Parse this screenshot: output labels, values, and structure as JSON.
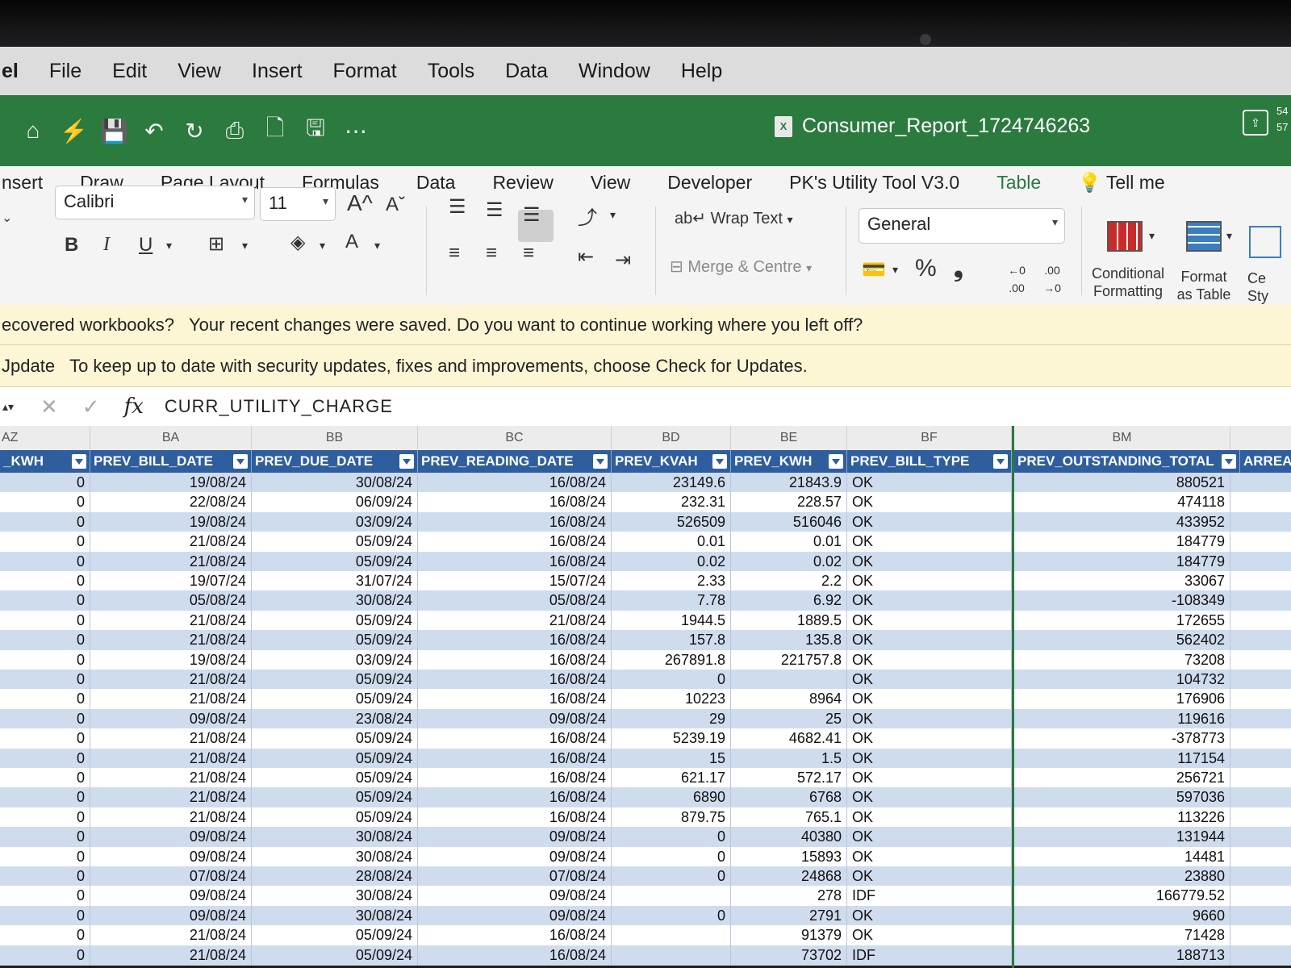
{
  "menu": [
    "el",
    "File",
    "Edit",
    "View",
    "Insert",
    "Format",
    "Tools",
    "Data",
    "Window",
    "Help"
  ],
  "title_bar": {
    "document_title": "Consumer_Report_1724746263",
    "clock": [
      "54",
      "57"
    ],
    "qat_icons": [
      "home-icon",
      "autosave-icon",
      "save-icon",
      "undo-icon",
      "redo-icon",
      "print-icon",
      "new-icon",
      "save-as-icon",
      "more-icon"
    ]
  },
  "ribbon_tabs": [
    "nsert",
    "Draw",
    "Page Layout",
    "Formulas",
    "Data",
    "Review",
    "View",
    "Developer",
    "PK's Utility Tool V3.0",
    "Table",
    "Tell me"
  ],
  "ribbon": {
    "font_name": "Calibri",
    "font_size": "11",
    "grow_font": "A^",
    "shrink_font": "Aˇ",
    "bold": "B",
    "italic": "I",
    "underline": "U",
    "wrap_text": "Wrap Text",
    "merge_centre": "Merge & Centre",
    "number_format": "General",
    "percent": "%",
    "comma": "❟",
    "increase_decimal": "←0 .00",
    "decrease_decimal": ".00 →0",
    "conditional_formatting": [
      "Conditional",
      "Formatting"
    ],
    "format_as_table": [
      "Format",
      "as Table"
    ],
    "cell_styles": [
      "Ce",
      "Sty"
    ]
  },
  "messages": [
    {
      "title": "ecovered workbooks?",
      "text": "Your recent changes were saved. Do you want to continue working where you left off?"
    },
    {
      "title": "Jpdate",
      "text": "To keep up to date with security updates, fixes and improvements, choose Check for Updates."
    }
  ],
  "formula_bar": {
    "cancel": "✕",
    "enter": "✓",
    "fx": "fx",
    "value": "CURR_UTILITY_CHARGE"
  },
  "columns": [
    "AZ",
    "BA",
    "BB",
    "BC",
    "BD",
    "BE",
    "BF",
    "BM"
  ],
  "headers": [
    "_KWH",
    "PREV_BILL_DATE",
    "PREV_DUE_DATE",
    "PREV_READING_DATE",
    "PREV_KVAH",
    "PREV_KWH",
    "PREV_BILL_TYPE",
    "PREV_OUTSTANDING_TOTAL",
    "ARREAR"
  ],
  "rows": [
    [
      "0",
      "19/08/24",
      "30/08/24",
      "16/08/24",
      "23149.6",
      "21843.9",
      "OK",
      "880521"
    ],
    [
      "0",
      "22/08/24",
      "06/09/24",
      "16/08/24",
      "232.31",
      "228.57",
      "OK",
      "474118"
    ],
    [
      "0",
      "19/08/24",
      "03/09/24",
      "16/08/24",
      "526509",
      "516046",
      "OK",
      "433952"
    ],
    [
      "0",
      "21/08/24",
      "05/09/24",
      "16/08/24",
      "0.01",
      "0.01",
      "OK",
      "184779"
    ],
    [
      "0",
      "21/08/24",
      "05/09/24",
      "16/08/24",
      "0.02",
      "0.02",
      "OK",
      "184779"
    ],
    [
      "0",
      "19/07/24",
      "31/07/24",
      "15/07/24",
      "2.33",
      "2.2",
      "OK",
      "33067"
    ],
    [
      "0",
      "05/08/24",
      "30/08/24",
      "05/08/24",
      "7.78",
      "6.92",
      "OK",
      "-108349"
    ],
    [
      "0",
      "21/08/24",
      "05/09/24",
      "21/08/24",
      "1944.5",
      "1889.5",
      "OK",
      "172655"
    ],
    [
      "0",
      "21/08/24",
      "05/09/24",
      "16/08/24",
      "157.8",
      "135.8",
      "OK",
      "562402"
    ],
    [
      "0",
      "19/08/24",
      "03/09/24",
      "16/08/24",
      "267891.8",
      "221757.8",
      "OK",
      "73208"
    ],
    [
      "0",
      "21/08/24",
      "05/09/24",
      "16/08/24",
      "0",
      "",
      "OK",
      "104732"
    ],
    [
      "0",
      "21/08/24",
      "05/09/24",
      "16/08/24",
      "10223",
      "8964",
      "OK",
      "176906"
    ],
    [
      "0",
      "09/08/24",
      "23/08/24",
      "09/08/24",
      "29",
      "25",
      "OK",
      "119616"
    ],
    [
      "0",
      "21/08/24",
      "05/09/24",
      "16/08/24",
      "5239.19",
      "4682.41",
      "OK",
      "-378773"
    ],
    [
      "0",
      "21/08/24",
      "05/09/24",
      "16/08/24",
      "15",
      "1.5",
      "OK",
      "117154"
    ],
    [
      "0",
      "21/08/24",
      "05/09/24",
      "16/08/24",
      "621.17",
      "572.17",
      "OK",
      "256721"
    ],
    [
      "0",
      "21/08/24",
      "05/09/24",
      "16/08/24",
      "6890",
      "6768",
      "OK",
      "597036"
    ],
    [
      "0",
      "21/08/24",
      "05/09/24",
      "16/08/24",
      "879.75",
      "765.1",
      "OK",
      "113226"
    ],
    [
      "0",
      "09/08/24",
      "30/08/24",
      "09/08/24",
      "0",
      "40380",
      "OK",
      "131944"
    ],
    [
      "0",
      "09/08/24",
      "30/08/24",
      "09/08/24",
      "0",
      "15893",
      "OK",
      "14481"
    ],
    [
      "0",
      "07/08/24",
      "28/08/24",
      "07/08/24",
      "0",
      "24868",
      "OK",
      "23880"
    ],
    [
      "0",
      "09/08/24",
      "30/08/24",
      "09/08/24",
      "",
      "278",
      "IDF",
      "166779.52"
    ],
    [
      "0",
      "09/08/24",
      "30/08/24",
      "09/08/24",
      "0",
      "2791",
      "OK",
      "9660"
    ],
    [
      "0",
      "21/08/24",
      "05/09/24",
      "16/08/24",
      "",
      "91379",
      "OK",
      "71428"
    ],
    [
      "0",
      "21/08/24",
      "05/09/24",
      "16/08/24",
      "",
      "73702",
      "IDF",
      "188713"
    ]
  ]
}
